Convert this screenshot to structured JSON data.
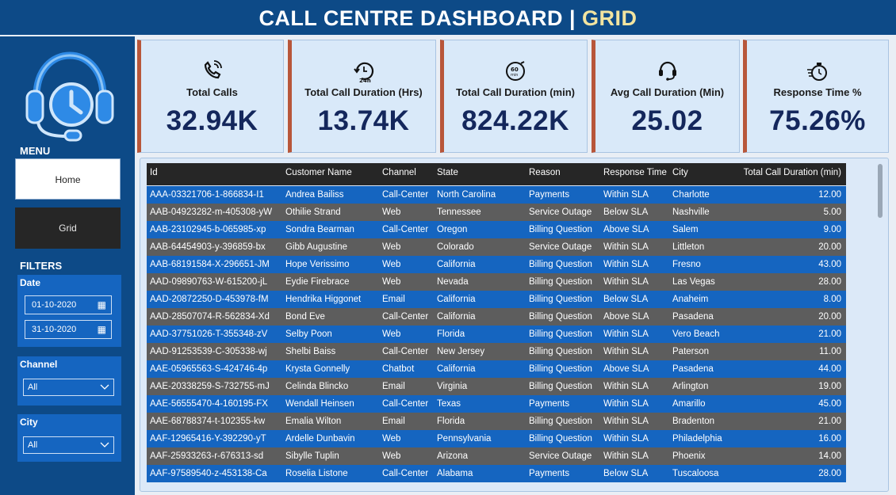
{
  "header": {
    "title_main": "CALL CENTRE DASHBOARD",
    "separator": "|",
    "title_page": "GRID"
  },
  "colors": {
    "header_bg": "#0d4a87",
    "accent_title": "#f2e4a0",
    "kpi_bg": "#d9e9f9",
    "kpi_border_accent": "#b8563a",
    "row_blue": "#1565c0",
    "row_gray": "#5d5d5d",
    "table_header": "#262626"
  },
  "sidebar": {
    "logo_icon": "headset-clock-icon",
    "menu_label": "MENU",
    "menu_items": [
      {
        "label": "Home"
      },
      {
        "label": "Grid"
      }
    ],
    "filters_label": "FILTERS",
    "date": {
      "label": "Date",
      "start": "01-10-2020",
      "end": "31-10-2020"
    },
    "channel": {
      "label": "Channel",
      "value": "All"
    },
    "city": {
      "label": "City",
      "value": "All"
    }
  },
  "kpis": [
    {
      "icon": "phone-icon",
      "label": "Total Calls",
      "value": "32.94K"
    },
    {
      "icon": "24h-clock-icon",
      "label": "Total Call Duration (Hrs)",
      "value": "13.74K"
    },
    {
      "icon": "60min-timer-icon",
      "label": "Total Call Duration (min)",
      "value": "824.22K"
    },
    {
      "icon": "headset-icon",
      "label": "Avg Call Duration (Min)",
      "value": "25.02"
    },
    {
      "icon": "stopwatch-icon",
      "label": "Response Time %",
      "value": "75.26%"
    }
  ],
  "table": {
    "columns": [
      "Id",
      "Customer Name",
      "Channel",
      "State",
      "Reason",
      "Response Time",
      "City",
      "Total Call Duration (min)"
    ],
    "rows": [
      [
        "AAA-03321706-1-866834-I1",
        "Andrea Bailiss",
        "Call-Center",
        "North Carolina",
        "Payments",
        "Within SLA",
        "Charlotte",
        "12.00"
      ],
      [
        "AAB-04923282-m-405308-yW",
        "Othilie Strand",
        "Web",
        "Tennessee",
        "Service Outage",
        "Below SLA",
        "Nashville",
        "5.00"
      ],
      [
        "AAB-23102945-b-065985-xp",
        "Sondra Bearman",
        "Call-Center",
        "Oregon",
        "Billing Question",
        "Above SLA",
        "Salem",
        "9.00"
      ],
      [
        "AAB-64454903-y-396859-bx",
        "Gibb Augustine",
        "Web",
        "Colorado",
        "Service Outage",
        "Within SLA",
        "Littleton",
        "20.00"
      ],
      [
        "AAB-68191584-X-296651-JM",
        "Hope Verissimo",
        "Web",
        "California",
        "Billing Question",
        "Within SLA",
        "Fresno",
        "43.00"
      ],
      [
        "AAD-09890763-W-615200-jL",
        "Eydie Firebrace",
        "Web",
        "Nevada",
        "Billing Question",
        "Within SLA",
        "Las Vegas",
        "28.00"
      ],
      [
        "AAD-20872250-D-453978-fM",
        "Hendrika Higgonet",
        "Email",
        "California",
        "Billing Question",
        "Below SLA",
        "Anaheim",
        "8.00"
      ],
      [
        "AAD-28507074-R-562834-Xd",
        "Bond Eve",
        "Call-Center",
        "California",
        "Billing Question",
        "Above SLA",
        "Pasadena",
        "20.00"
      ],
      [
        "AAD-37751026-T-355348-zV",
        "Selby Poon",
        "Web",
        "Florida",
        "Billing Question",
        "Within SLA",
        "Vero Beach",
        "21.00"
      ],
      [
        "AAD-91253539-C-305338-wj",
        "Shelbi Baiss",
        "Call-Center",
        "New Jersey",
        "Billing Question",
        "Within SLA",
        "Paterson",
        "11.00"
      ],
      [
        "AAE-05965563-S-424746-4p",
        "Krysta Gonnelly",
        "Chatbot",
        "California",
        "Billing Question",
        "Above SLA",
        "Pasadena",
        "44.00"
      ],
      [
        "AAE-20338259-S-732755-mJ",
        "Celinda Blincko",
        "Email",
        "Virginia",
        "Billing Question",
        "Within SLA",
        "Arlington",
        "19.00"
      ],
      [
        "AAE-56555470-4-160195-FX",
        "Wendall Heinsen",
        "Call-Center",
        "Texas",
        "Payments",
        "Within SLA",
        "Amarillo",
        "45.00"
      ],
      [
        "AAE-68788374-t-102355-kw",
        "Emalia Wilton",
        "Email",
        "Florida",
        "Billing Question",
        "Within SLA",
        "Bradenton",
        "21.00"
      ],
      [
        "AAF-12965416-Y-392290-yT",
        "Ardelle Dunbavin",
        "Web",
        "Pennsylvania",
        "Billing Question",
        "Within SLA",
        "Philadelphia",
        "16.00"
      ],
      [
        "AAF-25933263-r-676313-sd",
        "Sibylle Tuplin",
        "Web",
        "Arizona",
        "Service Outage",
        "Within SLA",
        "Phoenix",
        "14.00"
      ],
      [
        "AAF-97589540-z-453138-Ca",
        "Roselia Listone",
        "Call-Center",
        "Alabama",
        "Payments",
        "Below SLA",
        "Tuscaloosa",
        "28.00"
      ]
    ]
  }
}
